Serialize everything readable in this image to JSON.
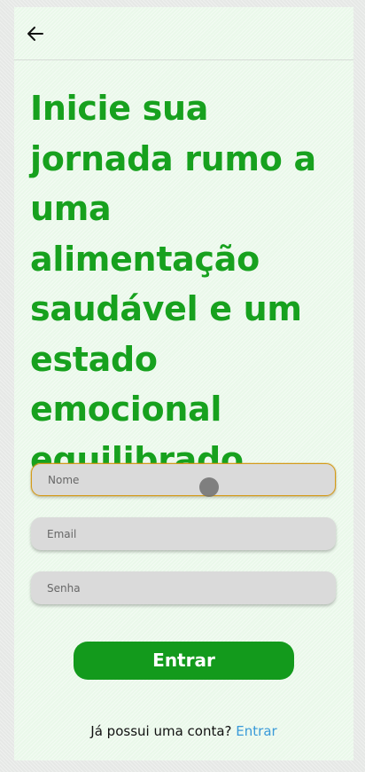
{
  "header": {
    "back_icon": "arrow-left-icon"
  },
  "main": {
    "headline": "Inicie sua jornada rumo a uma alimentação saudável e um estado emocional equilibrado"
  },
  "form": {
    "name_placeholder": "Nome",
    "email_placeholder": "Email",
    "password_placeholder": "Senha",
    "submit_label": "Entrar"
  },
  "footer": {
    "prompt_text": "Já possui uma conta?",
    "login_link": "Entrar"
  },
  "colors": {
    "primary_green": "#17a11e",
    "button_green": "#139a1c",
    "focus_border": "#d49a1a",
    "link_blue": "#3a9ad9"
  }
}
